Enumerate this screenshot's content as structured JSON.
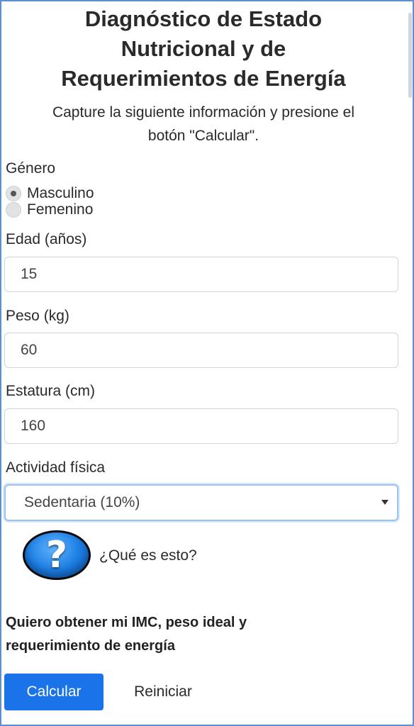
{
  "header": {
    "title_line1": "Diagnóstico de Estado",
    "title_line2": "Nutricional y de",
    "title_line3": "Requerimientos de Energía",
    "subtitle_line1": "Capture la siguiente información y presione el",
    "subtitle_line2": "botón \"Calcular\"."
  },
  "form": {
    "gender_label": "Género",
    "gender_options": [
      {
        "label": "Masculino",
        "checked": true
      },
      {
        "label": "Femenino",
        "checked": false
      }
    ],
    "age_label": "Edad (años)",
    "age_value": "15",
    "weight_label": "Peso (kg)",
    "weight_value": "60",
    "height_label": "Estatura (cm)",
    "height_value": "160",
    "activity_label": "Actividad física",
    "activity_value": "Sedentaria (10%)"
  },
  "help": {
    "icon": "question-mark-icon",
    "icon_glyph": "?",
    "link_text": "¿Qué es esto?"
  },
  "cta": {
    "line1": "Quiero obtener mi IMC, peso ideal y",
    "line2": "requerimiento de energía"
  },
  "buttons": {
    "calculate": "Calcular",
    "reset": "Reiniciar"
  },
  "colors": {
    "primary": "#1a73e8",
    "help_icon": "#1a7be0",
    "frame_border": "#5b8fd0"
  }
}
